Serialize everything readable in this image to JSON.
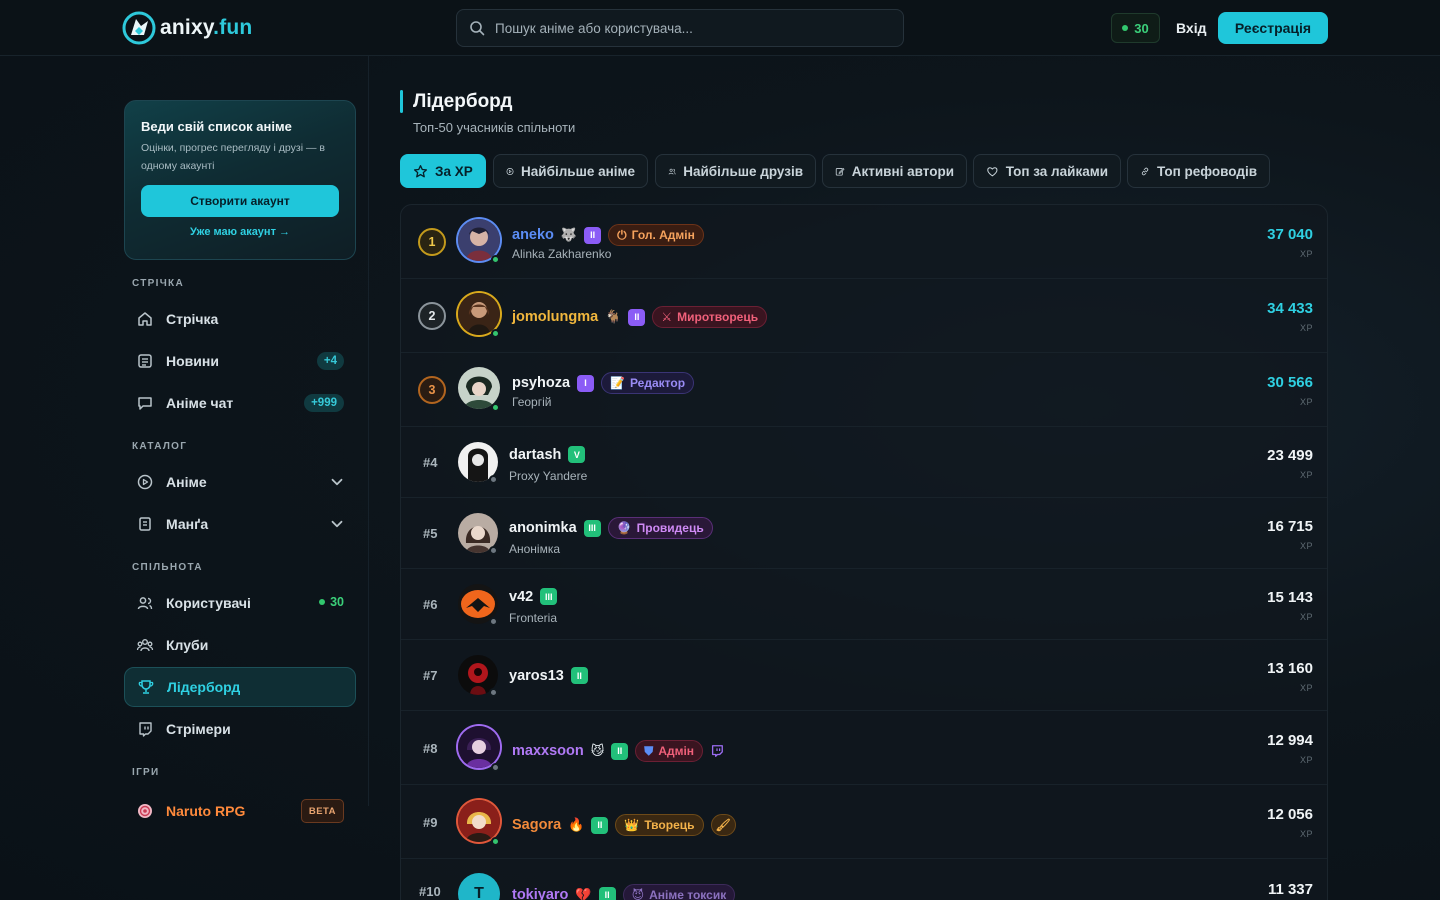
{
  "header": {
    "logo_text": "anixy",
    "logo_tld": ".fun",
    "search_placeholder": "Пошук аніме або користувача...",
    "online_count": "30",
    "login": "Вхід",
    "register": "Реєстрація"
  },
  "promo": {
    "title": "Веди свій список аніме",
    "text": "Оцінки, прогрес перегляду і друзі — в одному акаунті",
    "button": "Створити акаунт",
    "link": "Уже маю акаунт →"
  },
  "sidebar": {
    "section_feed": "СТРІЧКА",
    "feed": "Стрічка",
    "news": "Новини",
    "news_badge": "+4",
    "chat": "Аніме чат",
    "chat_badge": "+999",
    "section_catalog": "КАТАЛОГ",
    "anime": "Аніме",
    "manga": "Манґа",
    "section_community": "СПІЛЬНОТА",
    "users": "Користувачі",
    "users_online": "30",
    "clubs": "Клуби",
    "leaderboard": "Лідерборд",
    "streamers": "Стрімери",
    "section_games": "ІГРИ",
    "naruto": "Naruto RPG",
    "beta": "BETA"
  },
  "page": {
    "title": "Лідерборд",
    "subtitle": "Топ-50 учасників спільноти"
  },
  "tabs": [
    {
      "label": "За XP"
    },
    {
      "label": "Найбільше аніме"
    },
    {
      "label": "Найбільше друзів"
    },
    {
      "label": "Активні автори"
    },
    {
      "label": "Топ за лайками"
    },
    {
      "label": "Топ рефоводів"
    }
  ],
  "xp_unit": "XP",
  "leaders": [
    {
      "rank": "1",
      "username": "aneko",
      "subtitle": "Alinka Zakharenko",
      "level": "II",
      "role": "Гол. Адмін",
      "xp": "37 040",
      "name_color": "#5b8df5",
      "xp_color": "#2fd0e2",
      "online": true
    },
    {
      "rank": "2",
      "username": "jomolungma",
      "subtitle": "",
      "level": "II",
      "role": "Миротворець",
      "xp": "34 433",
      "name_color": "#f1b73d",
      "xp_color": "#2fd0e2",
      "online": true
    },
    {
      "rank": "3",
      "username": "psyhoza",
      "subtitle": "Георгій",
      "level": "I",
      "role": "Редактор",
      "xp": "30 566",
      "name_color": "#f0f4f6",
      "xp_color": "#2fd0e2",
      "online": true
    },
    {
      "rank": "#4",
      "username": "dartash",
      "subtitle": "Proxy Yandere",
      "level": "V",
      "role": "",
      "xp": "23 499",
      "name_color": "#f0f4f6",
      "xp_color": "#f0f4f6",
      "online": false
    },
    {
      "rank": "#5",
      "username": "anonimka",
      "subtitle": "Анонімка",
      "level": "III",
      "role": "Провидець",
      "xp": "16 715",
      "name_color": "#f0f4f6",
      "xp_color": "#f0f4f6",
      "online": false
    },
    {
      "rank": "#6",
      "username": "v42",
      "subtitle": "Fronteria",
      "level": "III",
      "role": "",
      "xp": "15 143",
      "name_color": "#f0f4f6",
      "xp_color": "#f0f4f6",
      "online": false
    },
    {
      "rank": "#7",
      "username": "yaros13",
      "subtitle": "",
      "level": "II",
      "role": "",
      "xp": "13 160",
      "name_color": "#f0f4f6",
      "xp_color": "#f0f4f6",
      "online": false
    },
    {
      "rank": "#8",
      "username": "maxxsoon",
      "subtitle": "",
      "level": "II",
      "role": "Адмін",
      "xp": "12 994",
      "name_color": "#b079f5",
      "xp_color": "#f0f4f6",
      "online": false
    },
    {
      "rank": "#9",
      "username": "Sagora",
      "subtitle": "",
      "level": "II",
      "role": "Творець",
      "xp": "12 056",
      "name_color": "#f28a3a",
      "xp_color": "#f0f4f6",
      "online": true
    },
    {
      "rank": "#10",
      "username": "tokiyaro",
      "subtitle": "",
      "level": "II",
      "role": "Аніме токсик",
      "xp": "11 337",
      "name_color": "#b079f5",
      "xp_color": "#f0f4f6",
      "online": false
    }
  ],
  "colors": {
    "accent": "#1fc6da",
    "online": "#34c56e",
    "background": "#0d151b"
  }
}
